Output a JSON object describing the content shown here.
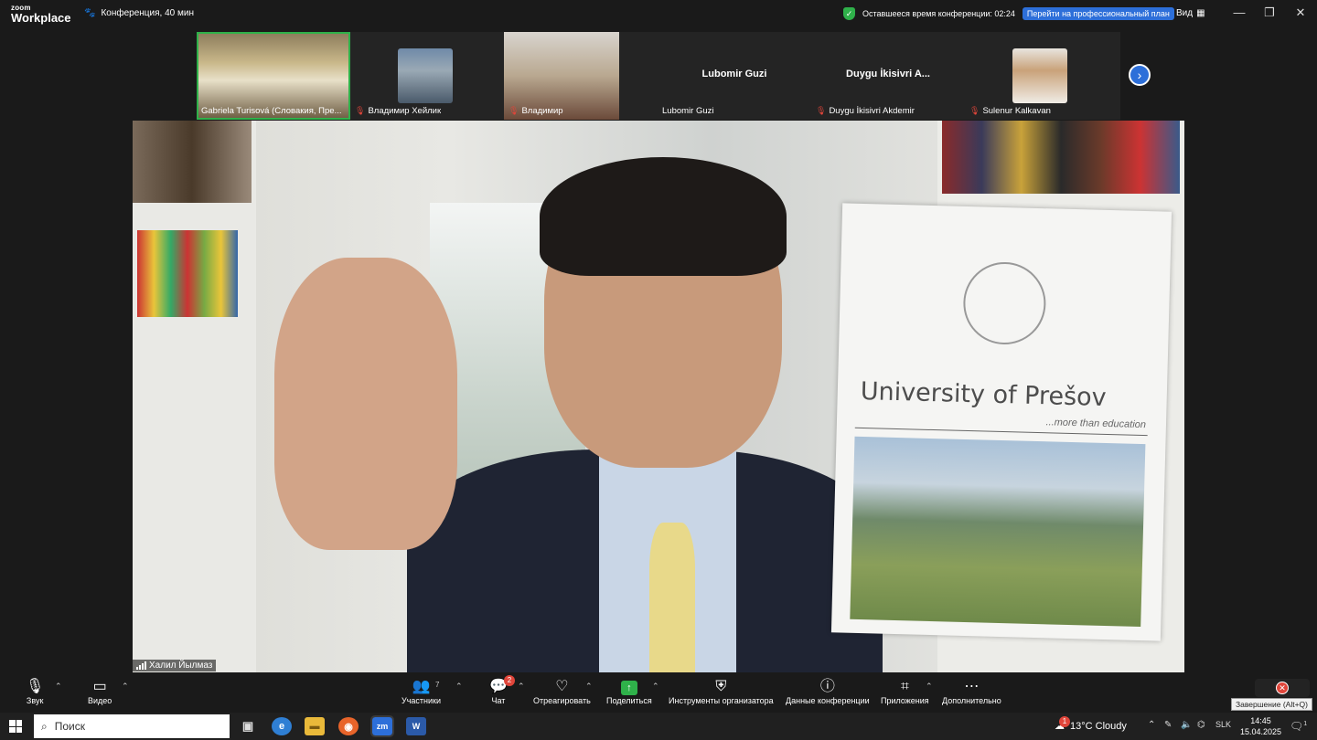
{
  "titlebar": {
    "logo_line1": "zoom",
    "logo_line2": "Workplace",
    "meeting_name": "Конференция, 40 мин",
    "time_left_label": "Оставшееся время конференции: 02:24",
    "upgrade_label": "Перейти на профессиональный план",
    "view_label": "Вид"
  },
  "participants": [
    {
      "name": "Gabriela Turisová (Словакия, Пре...",
      "video": true,
      "active": true,
      "muted": false
    },
    {
      "name": "Владимир Хейлик",
      "video": true,
      "muted": true
    },
    {
      "name": "Владимир",
      "video": true,
      "muted": true
    },
    {
      "name": "Lubomir Guzi",
      "display_name": "Lubomir Guzi",
      "video": false,
      "muted": false
    },
    {
      "name": "Duygu İkisivri Akdemir",
      "display_name": "Duygu İkisivri A...",
      "video": false,
      "muted": true
    },
    {
      "name": "Sulenur Kalkavan",
      "video": true,
      "muted": true
    }
  ],
  "main_video": {
    "speaker_name": "Халил Йылмаз",
    "brochure_title": "University of Prešov",
    "brochure_tagline": "...more than education"
  },
  "toolbar": {
    "audio": "Звук",
    "video": "Видео",
    "participants": "Участники",
    "participants_count": "7",
    "chat": "Чат",
    "chat_badge": "2",
    "react": "Отреагировать",
    "share": "Поделиться",
    "host_tools": "Инструменты организатора",
    "meeting_info": "Данные конференции",
    "apps": "Приложения",
    "more": "Дополнительно",
    "end_tooltip": "Завершение (Alt+Q)"
  },
  "taskbar": {
    "search_placeholder": "Поиск",
    "zoom_app": "zm",
    "word_app": "W",
    "weather": "13°C  Cloudy",
    "weather_badge": "1",
    "lang": "SLK",
    "time": "14:45",
    "date": "15.04.2025",
    "notif_count": "1"
  },
  "colors": {
    "accent_green": "#2fb14a",
    "accent_blue": "#2d6fd9",
    "danger_red": "#e0453a"
  }
}
